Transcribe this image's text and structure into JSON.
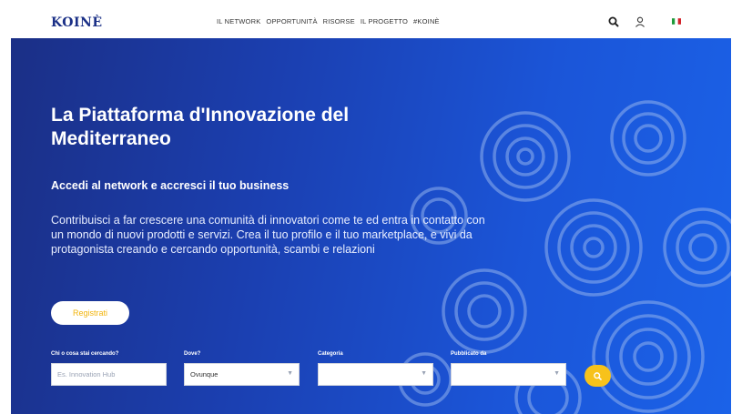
{
  "header": {
    "logo": "KOINÈ",
    "nav": [
      "IL NETWORK",
      "OPPORTUNITÀ",
      "RISORSE",
      "IL PROGETTO",
      "#KOINÈ"
    ],
    "icons": [
      "search-icon",
      "user-icon",
      "italian-flag-icon"
    ]
  },
  "hero": {
    "title": "La Piattaforma d'Innovazione del Mediterraneo",
    "subtitle": "Accedi al network e accresci il tuo business",
    "body": "Contribuisci a far crescere una comunità di innovatori come te ed entra in contatto con un mondo di nuovi prodotti e servizi. Crea il tuo profilo e il tuo marketplace, e vivi da protagonista creando e cercando opportunità, scambi e relazioni",
    "register_label": "Registrati"
  },
  "search": {
    "what_label": "Chi o cosa stai cercando?",
    "what_placeholder": "Es. Innovation Hub",
    "where_label": "Dove?",
    "where_value": "Ovunque",
    "category_label": "Categoria",
    "category_value": "",
    "published_label": "Pubblicato da",
    "published_value": ""
  },
  "colors": {
    "brand_blue": "#1b2f86",
    "hero_blue": "#1b55d8",
    "accent_yellow": "#f7c21b"
  }
}
